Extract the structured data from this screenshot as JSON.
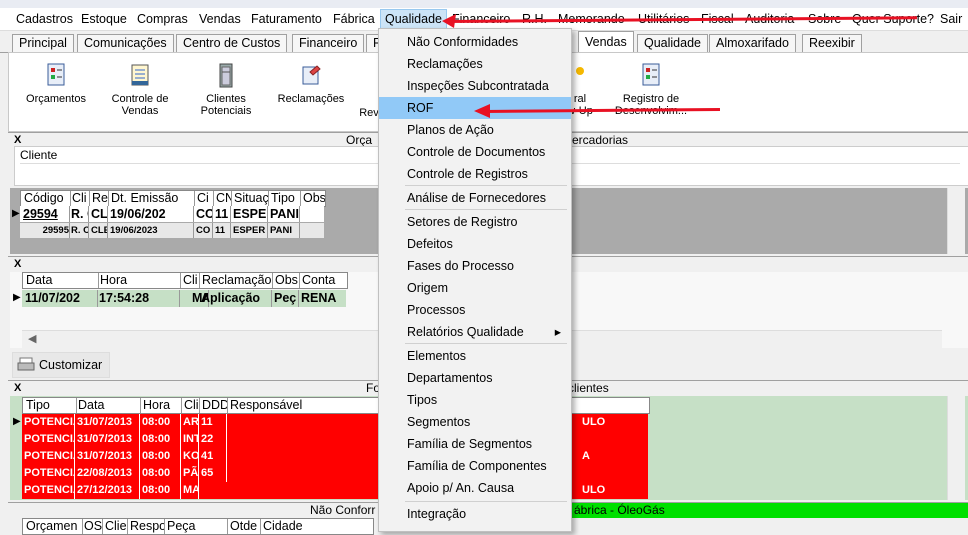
{
  "menubar": [
    "Cadastros",
    "Estoque",
    "Compras",
    "Vendas",
    "Faturamento",
    "Fábrica",
    "Qualidade",
    "Financeiro",
    "R.H.",
    "Memorando",
    "Utilitários",
    "Fiscal",
    "Auditoria",
    "Sobre",
    "Quer Suporte?",
    "Sair"
  ],
  "tabs": [
    "Principal",
    "Comunicações",
    "Centro de Custos",
    "Financeiro",
    "F",
    "Vendas",
    "Qualidade",
    "Almoxarifado",
    "Reexibir"
  ],
  "toolbar": {
    "orcamentos": "Orçamentos",
    "controle_vendas_1": "Controle de",
    "controle_vendas_2": "Vendas",
    "clientes_1": "Clientes",
    "clientes_2": "Potenciais",
    "reclamacoes": "Reclamações",
    "rev": "Rev",
    "geral_1": "ral",
    "geral_2": "w-Up",
    "registro_1": "Registro de",
    "registro_2": "Desenvolvim..."
  },
  "panel1": {
    "x": "X",
    "title_left": "Orça",
    "title_right": "ercadorias",
    "filter_label": "Cliente",
    "columns": [
      "Código",
      "Cli",
      "Re",
      "Dt. Emissão",
      "Ci",
      "CN",
      "Situaç",
      "Tipo",
      "Obs"
    ],
    "rows": [
      [
        "29594",
        "R. C",
        "CL",
        "19/06/202",
        "CO",
        "11",
        "ESPEI",
        "PANI",
        ""
      ],
      [
        "29595",
        "R. C",
        "CLE",
        "19/06/2023",
        "CO",
        "11",
        "ESPER",
        "PANI",
        ""
      ]
    ]
  },
  "panel2": {
    "x": "X",
    "columns": [
      "Data",
      "Hora",
      "Cli",
      "Reclamação",
      "Obs",
      "Conta"
    ],
    "row": [
      "11/07/202",
      "17:54:28",
      "MA",
      "Aplicação",
      "Peç",
      "RENA"
    ]
  },
  "customizar": "Customizar",
  "panel3": {
    "x": "X",
    "title_left": "Fo",
    "title_right": "clientes",
    "columns": [
      "Tipo",
      "Data",
      "Hora",
      "Cli",
      "DDD",
      "Responsável"
    ],
    "rows": [
      [
        "POTENCIA",
        "31/07/2013",
        "08:00",
        "AR",
        "11",
        "ULO"
      ],
      [
        "POTENCIA",
        "31/07/2013",
        "08:00",
        "INT",
        "22",
        ""
      ],
      [
        "POTENCIA",
        "31/07/2013",
        "08:00",
        "KO",
        "41",
        "A"
      ],
      [
        "POTENCIA",
        "22/08/2013",
        "08:00",
        "PÃ",
        "65",
        ""
      ],
      [
        "POTENCIA",
        "27/12/2013",
        "08:00",
        "MA",
        "",
        "ULO"
      ]
    ]
  },
  "panel4": {
    "title_left": "Não Conforr",
    "title_right": "ábrica - ÓleoGás",
    "columns": [
      "Orçamen",
      "OS",
      "Clie",
      "Respo",
      "Peça",
      "Otde",
      "Cidade"
    ]
  },
  "dropdown": [
    "Não Conformidades",
    "Reclamações",
    "Inspeções Subcontratada",
    "ROF",
    "Planos de Ação",
    "Controle de Documentos",
    "Controle de Registros",
    "Análise de Fornecedores",
    "Setores de Registro",
    "Defeitos",
    "Fases do Processo",
    "Origem",
    "Processos",
    "Relatórios Qualidade",
    "Elementos",
    "Departamentos",
    "Tipos",
    "Segmentos",
    "Família de Segmentos",
    "Família de Componentes",
    "Apoio p/ An. Causa",
    "Integração"
  ],
  "colors": {
    "accent_red": "#e81123",
    "highlight": "#91c9f7",
    "row_red": "#ff0000",
    "green": "#c6e0c6"
  }
}
